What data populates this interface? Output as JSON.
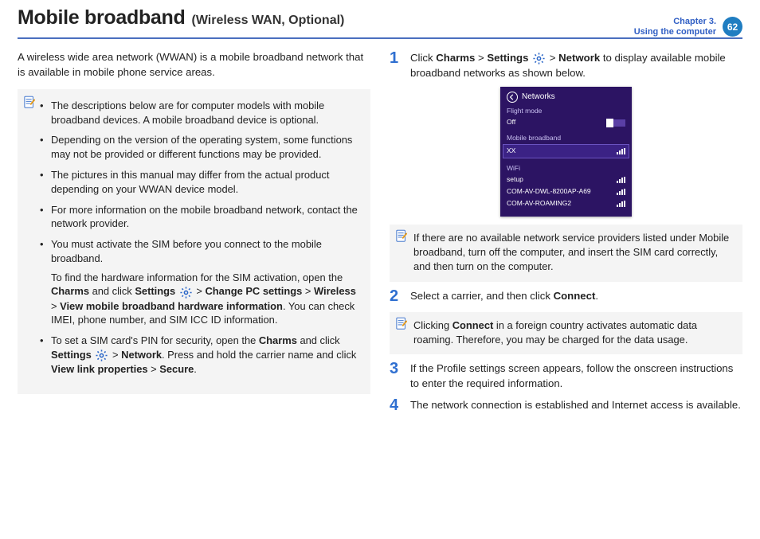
{
  "header": {
    "title": "Mobile broadband",
    "subtitle": "(Wireless WAN, Optional)",
    "chapter_line1": "Chapter 3.",
    "chapter_line2": "Using the computer",
    "page": "62"
  },
  "left": {
    "intro": "A wireless wide area network (WWAN) is a mobile broadband network that is available in mobile phone service areas.",
    "notes": {
      "b1": "The descriptions below are for computer models with mobile broadband devices. A mobile broadband device is optional.",
      "b2": "Depending on the version of the operating system, some functions may not be provided or different functions may be provided.",
      "b3": "The pictures in this manual may differ from the actual product depending on your WWAN device model.",
      "b4": "For more information on the mobile broadband network, contact the network provider.",
      "b5": "You must activate the SIM before you connect to the mobile broadband.",
      "b5_p_html": "To find the hardware information for the SIM activation, open the <b>Charms</b> and click <b>Settings</b> <svg class='gear-icon' data-name='gear-icon' data-interactable='false' viewBox='0 0 24 24'><circle cx='12' cy='12' r='3' fill='none' stroke='#2a66c8' stroke-width='2.2'/><path fill='none' stroke='#2a66c8' stroke-width='2.2' d='M12 2v3M12 19v3M2 12h3M19 12h3M4.9 4.9l2.1 2.1M17 17l2.1 2.1M19.1 4.9 17 7M7 17l-2.1 2.1'/></svg> > <b>Change PC settings</b> > <b>Wireless</b> > <b>View mobile broadband hardware information</b>. You can check IMEI, phone number, and SIM ICC ID information.",
      "b6_html": "To set a SIM card's PIN for security, open the <b>Charms</b> and click <b>Settings</b> <svg class='gear-icon' data-name='gear-icon' data-interactable='false' viewBox='0 0 24 24'><circle cx='12' cy='12' r='3' fill='none' stroke='#2a66c8' stroke-width='2.2'/><path fill='none' stroke='#2a66c8' stroke-width='2.2' d='M12 2v3M12 19v3M2 12h3M19 12h3M4.9 4.9l2.1 2.1M17 17l2.1 2.1M19.1 4.9 17 7M7 17l-2.1 2.1'/></svg> > <b>Network</b>. Press and hold the carrier name and click <b>View link properties</b> > <b>Secure</b>."
    }
  },
  "right": {
    "step1_html": "Click <b>Charms</b> > <b>Settings</b> <svg class='gear-icon' data-name='gear-icon' data-interactable='false' viewBox='0 0 24 24'><circle cx='12' cy='12' r='3' fill='none' stroke='#2a66c8' stroke-width='2.2'/><path fill='none' stroke='#2a66c8' stroke-width='2.2' d='M12 2v3M12 19v3M2 12h3M19 12h3M4.9 4.9l2.1 2.1M17 17l2.1 2.1M19.1 4.9 17 7M7 17l-2.1 2.1'/></svg> > <b>Network</b> to display available mobile broadband networks as shown below.",
    "screenshot": {
      "title": "Networks",
      "flight": "Flight mode",
      "off": "Off",
      "mb": "Mobile broadband",
      "xx": "XX",
      "wifi": "WiFi",
      "setup": "setup",
      "n1": "COM-AV-DWL-8200AP-A69",
      "n2": "COM-AV-ROAMING2"
    },
    "info2": "If there are no available network service providers listed under Mobile broadband, turn off the computer, and insert the SIM card correctly, and then turn on the computer.",
    "step2_html": "Select a carrier, and then click <b>Connect</b>.",
    "info3_html": "Clicking <b>Connect</b> in a foreign country activates automatic data roaming. Therefore, you may be charged for the data usage.",
    "step3": "If the Profile settings screen appears, follow the onscreen instructions to enter the required information.",
    "step4": "The network connection is established and Internet access is available."
  },
  "nums": {
    "s1": "1",
    "s2": "2",
    "s3": "3",
    "s4": "4"
  }
}
